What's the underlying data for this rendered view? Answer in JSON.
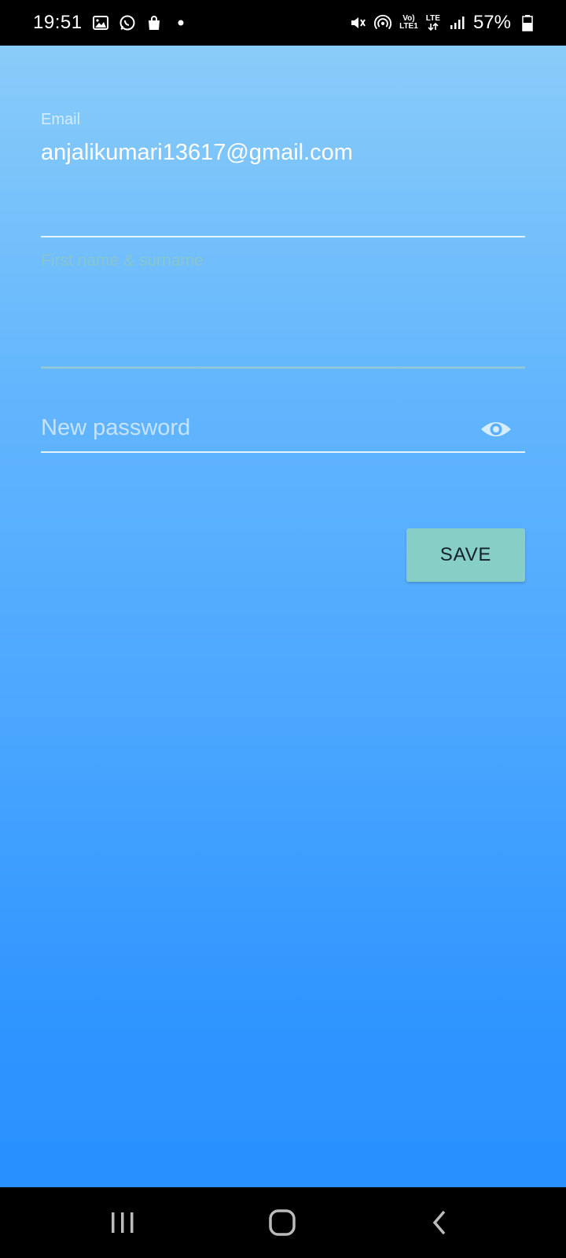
{
  "status_bar": {
    "time": "19:51",
    "battery_percent": "57%",
    "network_top": "Vo)",
    "network_bottom": "LTE1",
    "lte_label": "LTE",
    "icons": [
      "gallery-icon",
      "whatsapp-icon",
      "shopping-bag-icon",
      "dot-icon",
      "mute-icon",
      "hotspot-icon",
      "signal-icon",
      "battery-icon"
    ]
  },
  "form": {
    "email_label": "Email",
    "email_value": "anjalikumari13617@gmail.com",
    "name_placeholder": "First name & surname",
    "password_placeholder": "New password",
    "save_label": "SAVE"
  },
  "colors": {
    "gradient_top": "#89ccf9",
    "gradient_bottom": "#2991ff",
    "save_button": "#86cec6"
  },
  "nav_bar": {
    "icons": [
      "recents-icon",
      "home-icon",
      "back-icon"
    ]
  }
}
